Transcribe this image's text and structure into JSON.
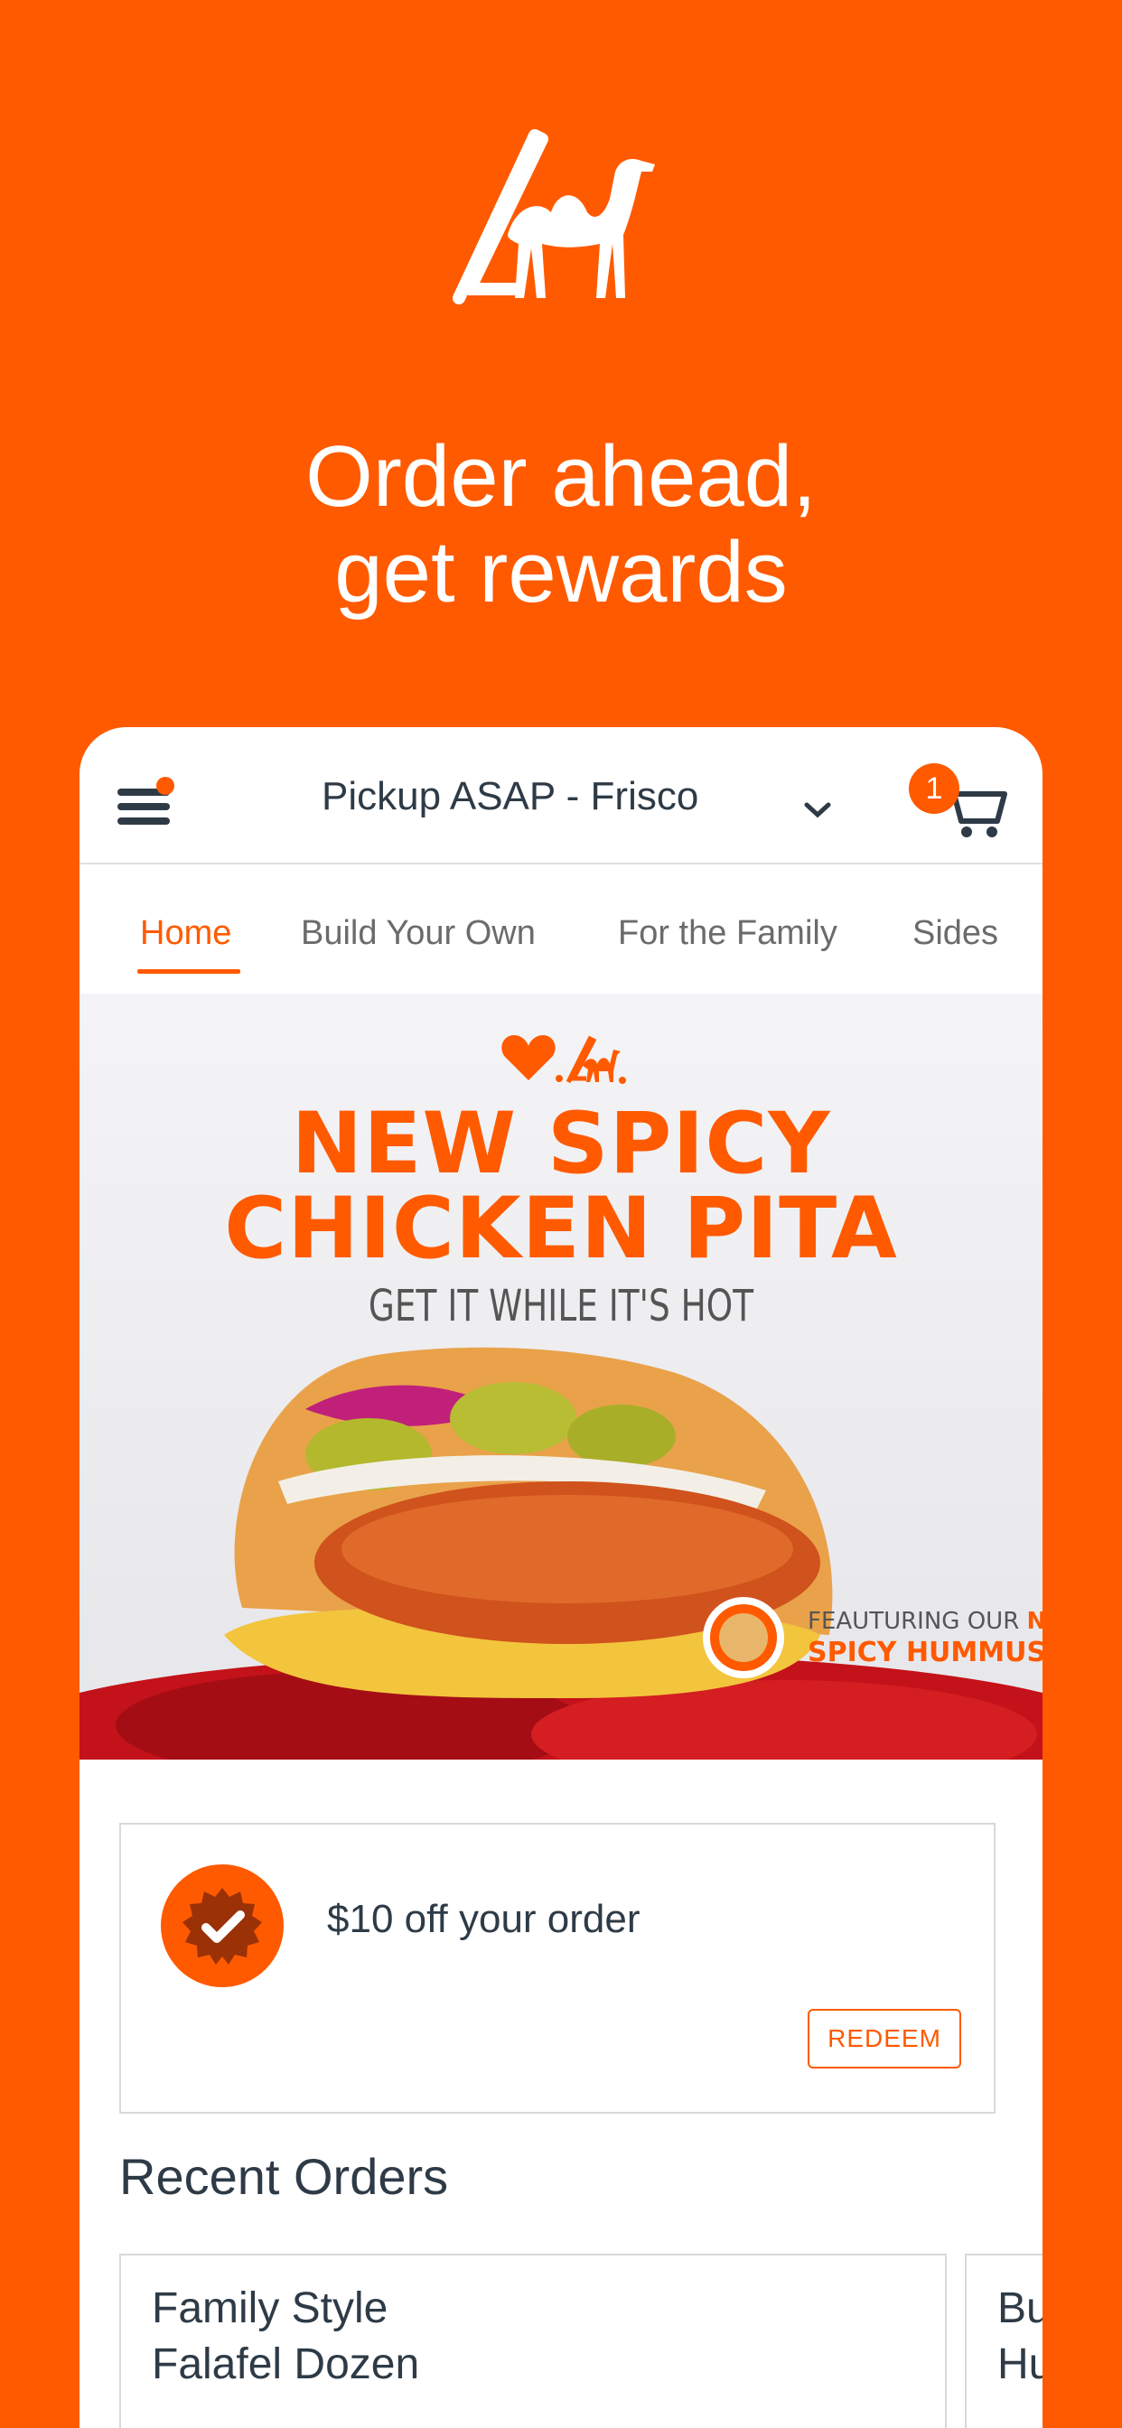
{
  "brand": {
    "logo_icon": "camel-tent-logo-icon",
    "headline": [
      "Order ahead,",
      "get rewards"
    ],
    "accent_color": "#FF5A00"
  },
  "header": {
    "location_label": "Pickup ASAP - Frisco",
    "cart_count": "1"
  },
  "tabs": [
    {
      "label": "Home",
      "active": true
    },
    {
      "label": "Build Your Own",
      "active": false
    },
    {
      "label": "For the Family",
      "active": false
    },
    {
      "label": "Sides",
      "active": false
    }
  ],
  "banner": {
    "title_lines": [
      "NEW SPICY",
      "CHICKEN PITA"
    ],
    "subtitle": "GET IT WHILE IT'S HOT",
    "feature_line1_prefix": "FEAUTURING OUR ",
    "feature_line1_highlight": "NEW!",
    "feature_line2": "SPICY HUMMUS"
  },
  "reward": {
    "text": "$10 off your order",
    "button_label": "REDEEM"
  },
  "recent_orders": {
    "title": "Recent Orders",
    "items": [
      {
        "lines": [
          "Family Style",
          "Falafel Dozen"
        ]
      },
      {
        "lines": [
          "Bu",
          "Hu"
        ]
      }
    ]
  }
}
